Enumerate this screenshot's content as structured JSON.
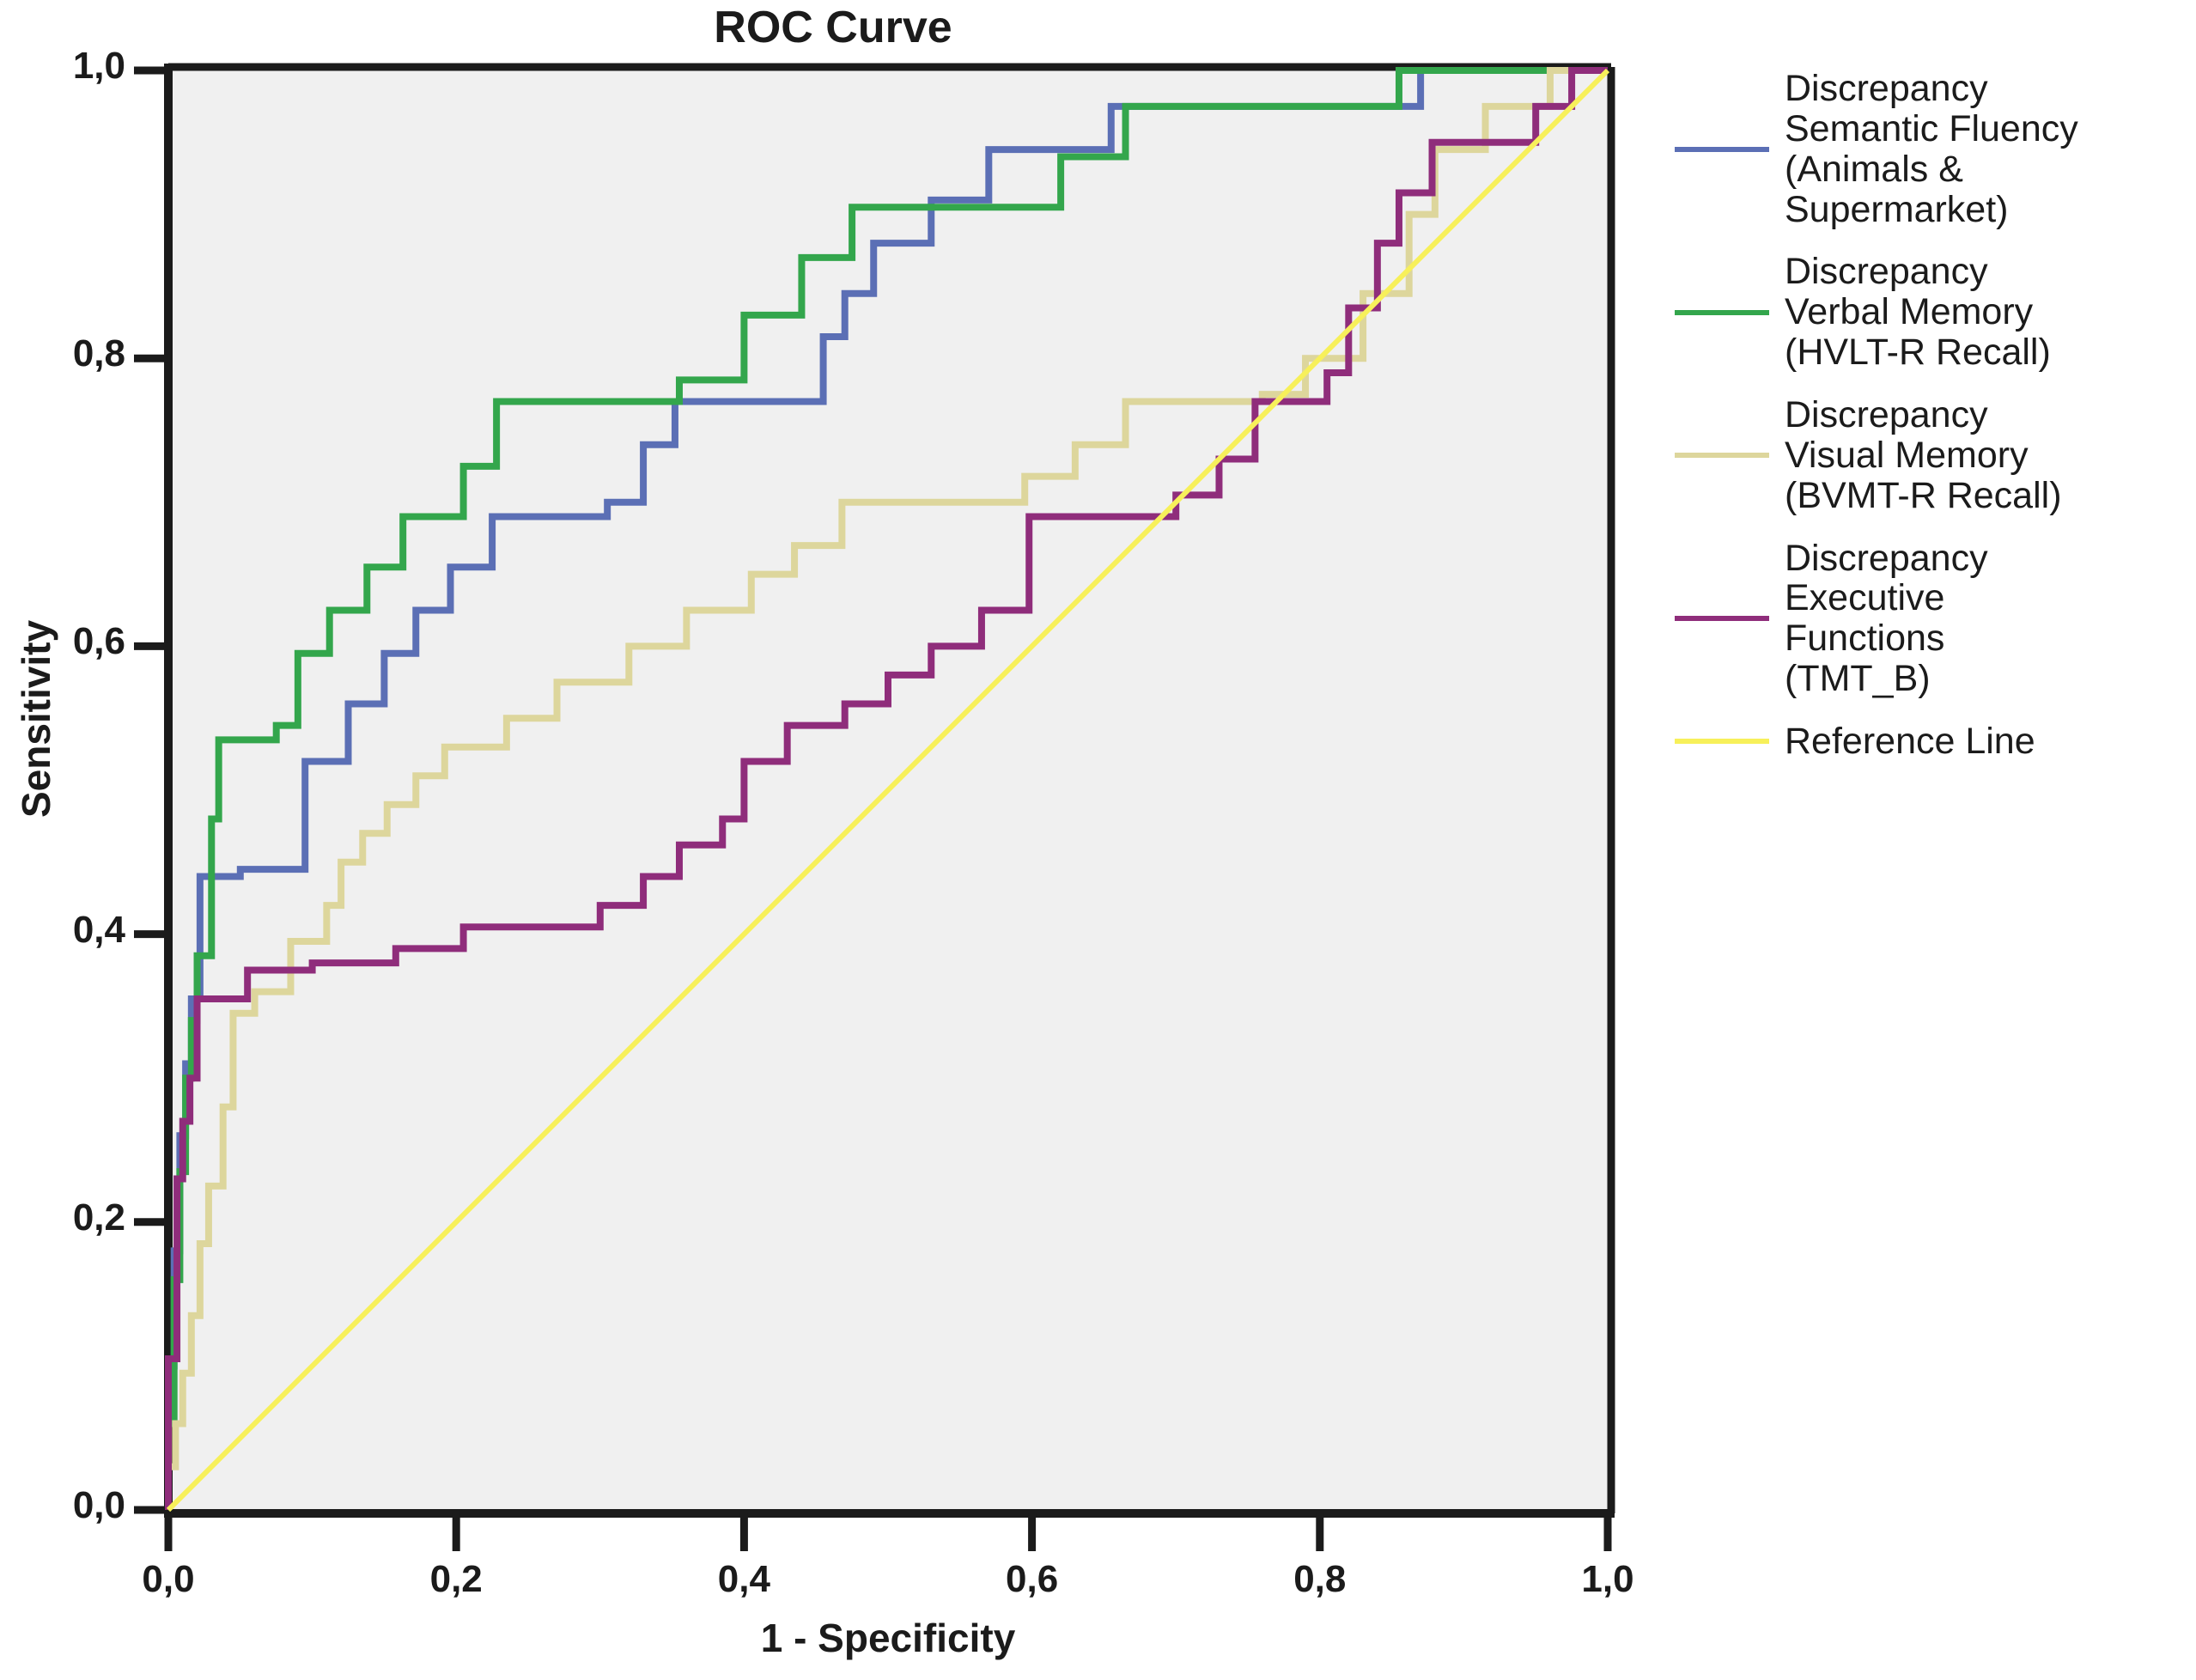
{
  "chart_data": {
    "type": "line",
    "title": "ROC Curve",
    "xlabel": "1 - Specificity",
    "ylabel": "Sensitivity",
    "xlim": [
      0,
      1
    ],
    "ylim": [
      0,
      1
    ],
    "grid": false,
    "background": "#f0f0f0",
    "legend_position": "right",
    "xticks": [
      "0,0",
      "0,2",
      "0,4",
      "0,6",
      "0,8",
      "1,0"
    ],
    "xtick_values": [
      0.0,
      0.2,
      0.4,
      0.6,
      0.8,
      1.0
    ],
    "yticks": [
      "0,0",
      "0,2",
      "0,4",
      "0,6",
      "0,8",
      "1,0"
    ],
    "ytick_values": [
      0.0,
      0.2,
      0.4,
      0.6,
      0.8,
      1.0
    ],
    "series": [
      {
        "name": "Discrepancy Semantic Fluency (Animals & Supermarket)",
        "color": "#5b6fb5",
        "points": [
          [
            0.0,
            0.0
          ],
          [
            0.0,
            0.1
          ],
          [
            0.004,
            0.1
          ],
          [
            0.004,
            0.18
          ],
          [
            0.008,
            0.18
          ],
          [
            0.008,
            0.26
          ],
          [
            0.012,
            0.26
          ],
          [
            0.012,
            0.31
          ],
          [
            0.016,
            0.31
          ],
          [
            0.016,
            0.355
          ],
          [
            0.022,
            0.355
          ],
          [
            0.022,
            0.44
          ],
          [
            0.05,
            0.44
          ],
          [
            0.05,
            0.445
          ],
          [
            0.095,
            0.445
          ],
          [
            0.095,
            0.52
          ],
          [
            0.125,
            0.52
          ],
          [
            0.125,
            0.56
          ],
          [
            0.15,
            0.56
          ],
          [
            0.15,
            0.595
          ],
          [
            0.172,
            0.595
          ],
          [
            0.172,
            0.625
          ],
          [
            0.196,
            0.625
          ],
          [
            0.196,
            0.655
          ],
          [
            0.225,
            0.655
          ],
          [
            0.225,
            0.69
          ],
          [
            0.305,
            0.69
          ],
          [
            0.305,
            0.7
          ],
          [
            0.33,
            0.7
          ],
          [
            0.33,
            0.74
          ],
          [
            0.352,
            0.74
          ],
          [
            0.352,
            0.77
          ],
          [
            0.455,
            0.77
          ],
          [
            0.455,
            0.815
          ],
          [
            0.47,
            0.815
          ],
          [
            0.47,
            0.845
          ],
          [
            0.49,
            0.845
          ],
          [
            0.49,
            0.88
          ],
          [
            0.53,
            0.88
          ],
          [
            0.53,
            0.91
          ],
          [
            0.57,
            0.91
          ],
          [
            0.57,
            0.945
          ],
          [
            0.655,
            0.945
          ],
          [
            0.655,
            0.975
          ],
          [
            0.87,
            0.975
          ],
          [
            0.87,
            1.0
          ],
          [
            1.0,
            1.0
          ]
        ]
      },
      {
        "name": "Discrepancy Verbal Memory (HVLT-R Recall)",
        "color": "#33a64c",
        "points": [
          [
            0.0,
            0.0
          ],
          [
            0.0,
            0.06
          ],
          [
            0.004,
            0.06
          ],
          [
            0.004,
            0.16
          ],
          [
            0.008,
            0.16
          ],
          [
            0.008,
            0.235
          ],
          [
            0.012,
            0.235
          ],
          [
            0.012,
            0.3
          ],
          [
            0.016,
            0.3
          ],
          [
            0.016,
            0.34
          ],
          [
            0.02,
            0.34
          ],
          [
            0.02,
            0.385
          ],
          [
            0.03,
            0.385
          ],
          [
            0.03,
            0.48
          ],
          [
            0.035,
            0.48
          ],
          [
            0.035,
            0.535
          ],
          [
            0.075,
            0.535
          ],
          [
            0.075,
            0.545
          ],
          [
            0.09,
            0.545
          ],
          [
            0.09,
            0.595
          ],
          [
            0.112,
            0.595
          ],
          [
            0.112,
            0.625
          ],
          [
            0.138,
            0.625
          ],
          [
            0.138,
            0.655
          ],
          [
            0.163,
            0.655
          ],
          [
            0.163,
            0.69
          ],
          [
            0.205,
            0.69
          ],
          [
            0.205,
            0.725
          ],
          [
            0.228,
            0.725
          ],
          [
            0.228,
            0.77
          ],
          [
            0.355,
            0.77
          ],
          [
            0.355,
            0.785
          ],
          [
            0.4,
            0.785
          ],
          [
            0.4,
            0.83
          ],
          [
            0.44,
            0.83
          ],
          [
            0.44,
            0.87
          ],
          [
            0.475,
            0.87
          ],
          [
            0.475,
            0.905
          ],
          [
            0.62,
            0.905
          ],
          [
            0.62,
            0.94
          ],
          [
            0.665,
            0.94
          ],
          [
            0.665,
            0.975
          ],
          [
            0.855,
            0.975
          ],
          [
            0.855,
            1.0
          ],
          [
            1.0,
            1.0
          ]
        ]
      },
      {
        "name": "Discrepancy Visual Memory (BVMT-R Recall)",
        "color": "#ddd69c",
        "points": [
          [
            0.0,
            0.0
          ],
          [
            0.0,
            0.03
          ],
          [
            0.005,
            0.03
          ],
          [
            0.005,
            0.06
          ],
          [
            0.01,
            0.06
          ],
          [
            0.01,
            0.095
          ],
          [
            0.016,
            0.095
          ],
          [
            0.016,
            0.135
          ],
          [
            0.022,
            0.135
          ],
          [
            0.022,
            0.185
          ],
          [
            0.028,
            0.185
          ],
          [
            0.028,
            0.225
          ],
          [
            0.038,
            0.225
          ],
          [
            0.038,
            0.28
          ],
          [
            0.045,
            0.28
          ],
          [
            0.045,
            0.345
          ],
          [
            0.06,
            0.345
          ],
          [
            0.06,
            0.36
          ],
          [
            0.085,
            0.36
          ],
          [
            0.085,
            0.395
          ],
          [
            0.11,
            0.395
          ],
          [
            0.11,
            0.42
          ],
          [
            0.12,
            0.42
          ],
          [
            0.12,
            0.45
          ],
          [
            0.135,
            0.45
          ],
          [
            0.135,
            0.47
          ],
          [
            0.152,
            0.47
          ],
          [
            0.152,
            0.49
          ],
          [
            0.172,
            0.49
          ],
          [
            0.172,
            0.51
          ],
          [
            0.192,
            0.51
          ],
          [
            0.192,
            0.53
          ],
          [
            0.235,
            0.53
          ],
          [
            0.235,
            0.55
          ],
          [
            0.27,
            0.55
          ],
          [
            0.27,
            0.575
          ],
          [
            0.32,
            0.575
          ],
          [
            0.32,
            0.6
          ],
          [
            0.36,
            0.6
          ],
          [
            0.36,
            0.625
          ],
          [
            0.405,
            0.625
          ],
          [
            0.405,
            0.65
          ],
          [
            0.435,
            0.65
          ],
          [
            0.435,
            0.67
          ],
          [
            0.468,
            0.67
          ],
          [
            0.468,
            0.7
          ],
          [
            0.595,
            0.7
          ],
          [
            0.595,
            0.718
          ],
          [
            0.63,
            0.718
          ],
          [
            0.63,
            0.74
          ],
          [
            0.665,
            0.74
          ],
          [
            0.665,
            0.77
          ],
          [
            0.76,
            0.77
          ],
          [
            0.76,
            0.775
          ],
          [
            0.79,
            0.775
          ],
          [
            0.79,
            0.8
          ],
          [
            0.83,
            0.8
          ],
          [
            0.83,
            0.845
          ],
          [
            0.862,
            0.845
          ],
          [
            0.862,
            0.9
          ],
          [
            0.88,
            0.9
          ],
          [
            0.88,
            0.945
          ],
          [
            0.915,
            0.945
          ],
          [
            0.915,
            0.975
          ],
          [
            0.96,
            0.975
          ],
          [
            0.96,
            1.0
          ],
          [
            1.0,
            1.0
          ]
        ]
      },
      {
        "name": "Discrepancy Executive Functions (TMT_B)",
        "color": "#8f2d7b",
        "points": [
          [
            0.0,
            0.0
          ],
          [
            0.0,
            0.105
          ],
          [
            0.006,
            0.105
          ],
          [
            0.006,
            0.23
          ],
          [
            0.01,
            0.23
          ],
          [
            0.01,
            0.27
          ],
          [
            0.015,
            0.27
          ],
          [
            0.015,
            0.3
          ],
          [
            0.02,
            0.3
          ],
          [
            0.02,
            0.355
          ],
          [
            0.055,
            0.355
          ],
          [
            0.055,
            0.375
          ],
          [
            0.1,
            0.375
          ],
          [
            0.1,
            0.38
          ],
          [
            0.158,
            0.38
          ],
          [
            0.158,
            0.39
          ],
          [
            0.205,
            0.39
          ],
          [
            0.205,
            0.405
          ],
          [
            0.3,
            0.405
          ],
          [
            0.3,
            0.42
          ],
          [
            0.33,
            0.42
          ],
          [
            0.33,
            0.44
          ],
          [
            0.355,
            0.44
          ],
          [
            0.355,
            0.462
          ],
          [
            0.385,
            0.462
          ],
          [
            0.385,
            0.48
          ],
          [
            0.4,
            0.48
          ],
          [
            0.4,
            0.52
          ],
          [
            0.43,
            0.52
          ],
          [
            0.43,
            0.545
          ],
          [
            0.47,
            0.545
          ],
          [
            0.47,
            0.56
          ],
          [
            0.5,
            0.56
          ],
          [
            0.5,
            0.58
          ],
          [
            0.53,
            0.58
          ],
          [
            0.53,
            0.6
          ],
          [
            0.565,
            0.6
          ],
          [
            0.565,
            0.625
          ],
          [
            0.598,
            0.625
          ],
          [
            0.598,
            0.69
          ],
          [
            0.7,
            0.69
          ],
          [
            0.7,
            0.705
          ],
          [
            0.73,
            0.705
          ],
          [
            0.73,
            0.73
          ],
          [
            0.755,
            0.73
          ],
          [
            0.755,
            0.77
          ],
          [
            0.805,
            0.77
          ],
          [
            0.805,
            0.79
          ],
          [
            0.82,
            0.79
          ],
          [
            0.82,
            0.835
          ],
          [
            0.84,
            0.835
          ],
          [
            0.84,
            0.88
          ],
          [
            0.855,
            0.88
          ],
          [
            0.855,
            0.915
          ],
          [
            0.878,
            0.915
          ],
          [
            0.878,
            0.95
          ],
          [
            0.95,
            0.95
          ],
          [
            0.95,
            0.975
          ],
          [
            0.975,
            0.975
          ],
          [
            0.975,
            1.0
          ],
          [
            1.0,
            1.0
          ]
        ]
      },
      {
        "name": "Reference Line",
        "color": "#f7f05a",
        "points": [
          [
            0.0,
            0.0
          ],
          [
            1.0,
            1.0
          ]
        ]
      }
    ]
  },
  "legend": {
    "items": [
      {
        "label": "Discrepancy\nSemantic Fluency\n(Animals &\nSupermarket)",
        "color": "#5b6fb5"
      },
      {
        "label": "Discrepancy\nVerbal Memory\n(HVLT-R Recall)",
        "color": "#33a64c"
      },
      {
        "label": "Discrepancy\nVisual Memory\n(BVMT-R Recall)",
        "color": "#ddd69c"
      },
      {
        "label": "Discrepancy\nExecutive\nFunctions\n(TMT_B)",
        "color": "#8f2d7b"
      },
      {
        "label": "Reference Line",
        "color": "#f7f05a"
      }
    ]
  }
}
